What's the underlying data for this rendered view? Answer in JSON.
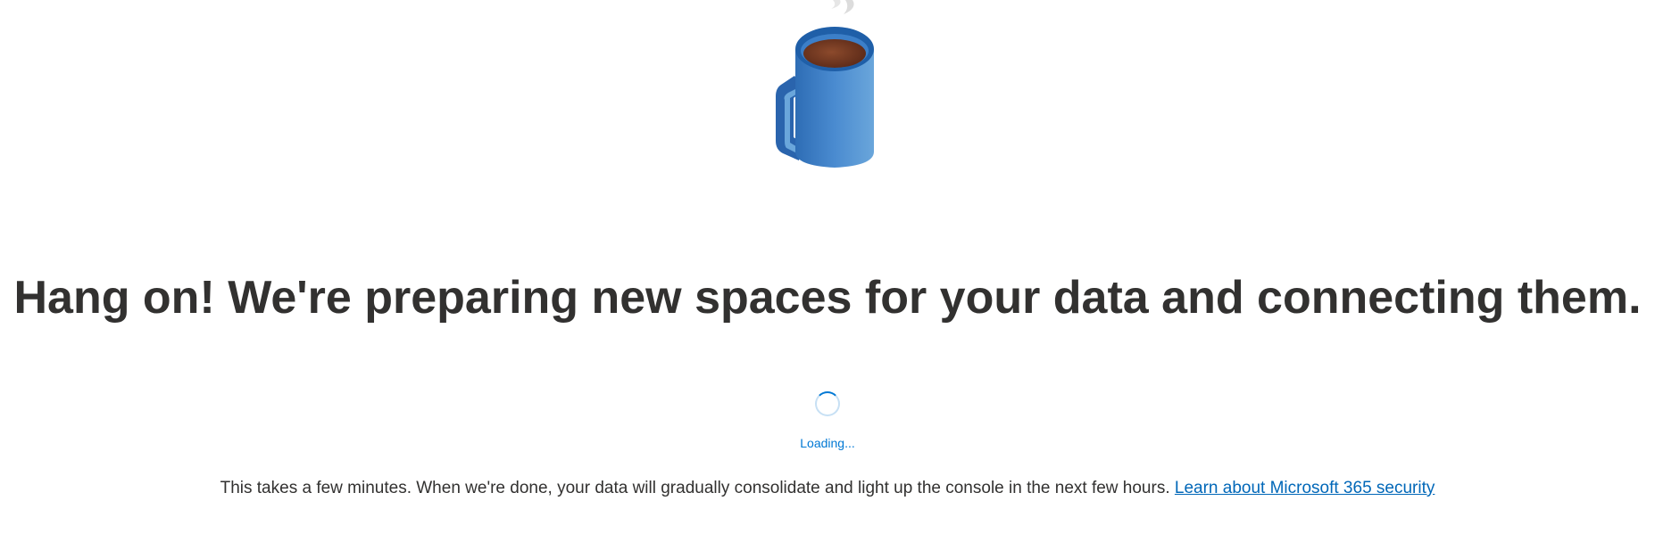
{
  "illustration": {
    "icon": "coffee-mug-icon",
    "colors": {
      "mug_light": "#5b9bd5",
      "mug_dark": "#2e6db5",
      "rim": "#1f5fa8",
      "coffee": "#7a3e26",
      "steam": "#e6e6e6"
    }
  },
  "main": {
    "headline": "Hang on! We're preparing new spaces for your data and connecting them.",
    "loading_label": "Loading...",
    "info_text": "This takes a few minutes. When we're done, your data will gradually consolidate and light up the console in the next few hours.",
    "learn_link": "Learn about Microsoft 365 security"
  },
  "colors": {
    "text": "#323130",
    "accent": "#0078d4",
    "link": "#0067b8",
    "background": "#ffffff"
  }
}
